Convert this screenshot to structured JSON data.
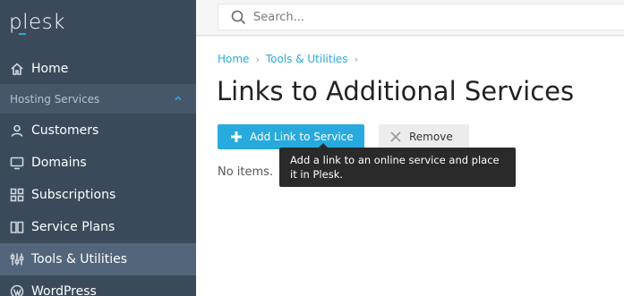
{
  "brand": {
    "logo_text": "plesk"
  },
  "search": {
    "placeholder": "Search..."
  },
  "sidebar": {
    "items": [
      {
        "label": "Home"
      },
      {
        "label": "Customers"
      },
      {
        "label": "Domains"
      },
      {
        "label": "Subscriptions"
      },
      {
        "label": "Service Plans"
      },
      {
        "label": "Tools & Utilities"
      },
      {
        "label": "WordPress"
      }
    ],
    "section_label": "Hosting Services"
  },
  "breadcrumb": {
    "items": [
      "Home",
      "Tools & Utilities"
    ]
  },
  "page": {
    "title": "Links to Additional Services",
    "add_button": "Add Link to Service",
    "remove_button": "Remove",
    "empty_text": "No items.",
    "tooltip": "Add a link to an online service and place it in Plesk."
  },
  "colors": {
    "accent": "#28aade",
    "sidebar_bg": "#3b4a5a",
    "active_item": "#52657a"
  }
}
